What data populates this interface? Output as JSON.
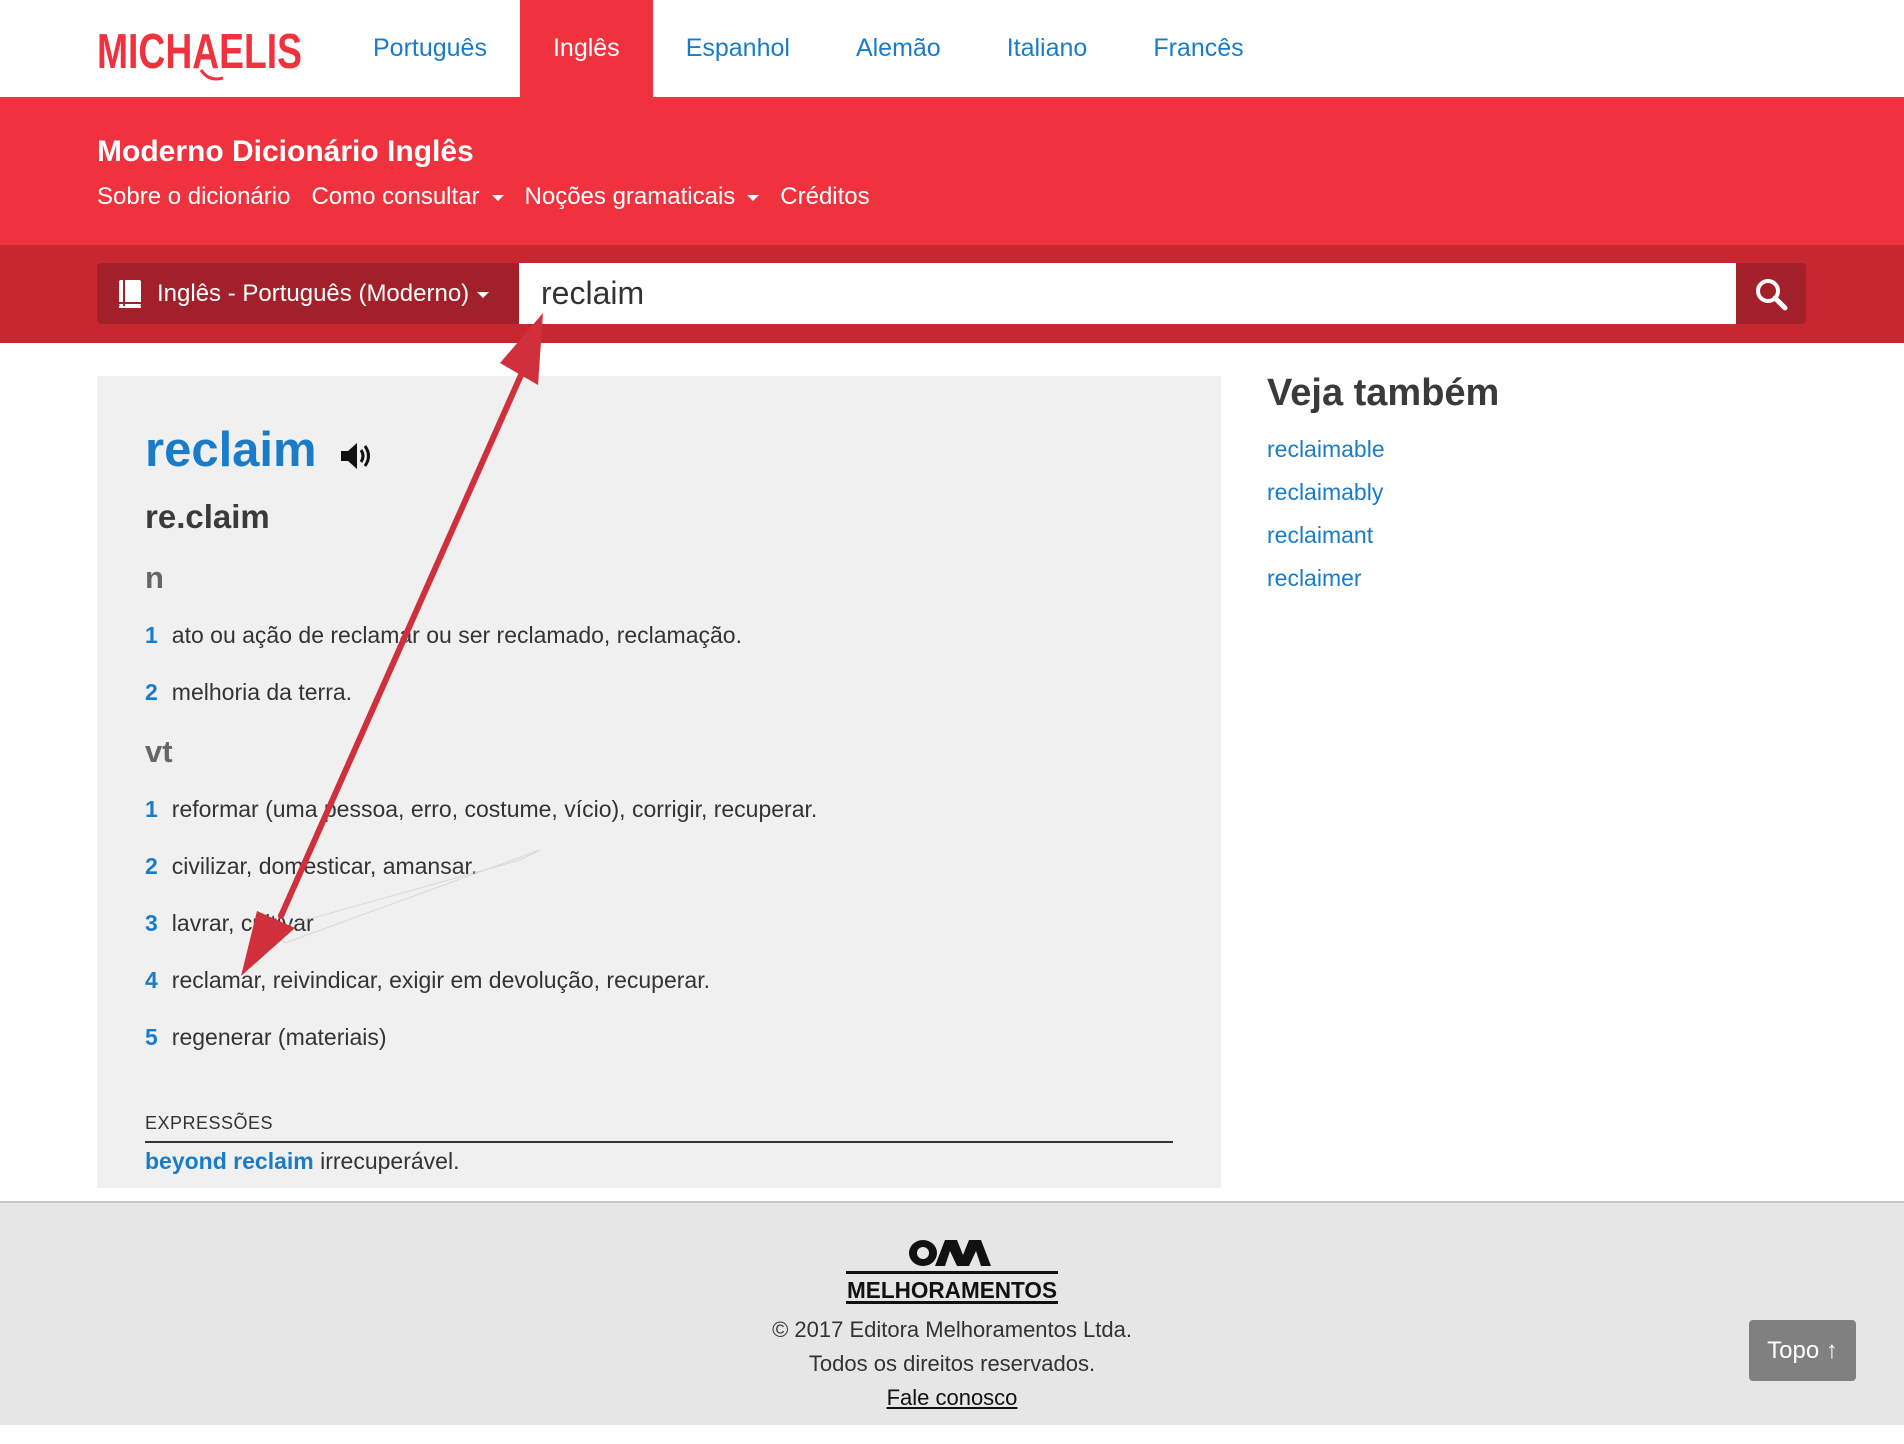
{
  "brand": {
    "logo_text": "MICHAELIS"
  },
  "nav": {
    "items": [
      {
        "label": "Português",
        "active": false
      },
      {
        "label": "Inglês",
        "active": true
      },
      {
        "label": "Espanhol",
        "active": false
      },
      {
        "label": "Alemão",
        "active": false
      },
      {
        "label": "Italiano",
        "active": false
      },
      {
        "label": "Francês",
        "active": false
      }
    ]
  },
  "header": {
    "title": "Moderno Dicionário Inglês",
    "subnav": [
      {
        "label": "Sobre o dicionário",
        "dropdown": false
      },
      {
        "label": "Como consultar",
        "dropdown": true
      },
      {
        "label": "Noções gramaticais",
        "dropdown": true
      },
      {
        "label": "Créditos",
        "dropdown": false
      }
    ]
  },
  "search": {
    "dictionary_selected": "Inglês - Português (Moderno)",
    "query": "reclaim",
    "button_icon": "search-icon"
  },
  "entry": {
    "headword": "reclaim",
    "syllabification": "re.claim",
    "sections": [
      {
        "pos": "n",
        "definitions": [
          {
            "num": "1",
            "text": "ato ou ação de reclamar ou ser reclamado, reclamação."
          },
          {
            "num": "2",
            "text": "melhoria da terra."
          }
        ]
      },
      {
        "pos": "vt",
        "definitions": [
          {
            "num": "1",
            "text": "reformar (uma pessoa, erro, costume, vício), corrigir, recuperar."
          },
          {
            "num": "2",
            "text": "civilizar, domesticar, amansar."
          },
          {
            "num": "3",
            "text": "lavrar, cultivar"
          },
          {
            "num": "4",
            "text": "reclamar, reivindicar, exigir em devolução, recuperar."
          },
          {
            "num": "5",
            "text": "regenerar (materiais)"
          }
        ]
      }
    ],
    "expressions_label": "EXPRESSÕES",
    "expressions": [
      {
        "phrase": "beyond reclaim",
        "meaning": " irrecuperável."
      }
    ]
  },
  "sidebar": {
    "title": "Veja também",
    "links": [
      "reclaimable",
      "reclaimably",
      "reclaimant",
      "reclaimer"
    ]
  },
  "footer": {
    "publisher_logo": "MELHORAMENTOS",
    "copyright": "© 2017 Editora Melhoramentos Ltda.",
    "rights": "Todos os direitos reservados.",
    "contact": "Fale conosco",
    "top_button": "Topo ↑"
  },
  "colors": {
    "brand_red": "#f0323f",
    "search_band": "#c8272f",
    "dark_red": "#a2202a",
    "link_blue": "#1a7cc9",
    "annotation_arrow": "#d0303c"
  }
}
